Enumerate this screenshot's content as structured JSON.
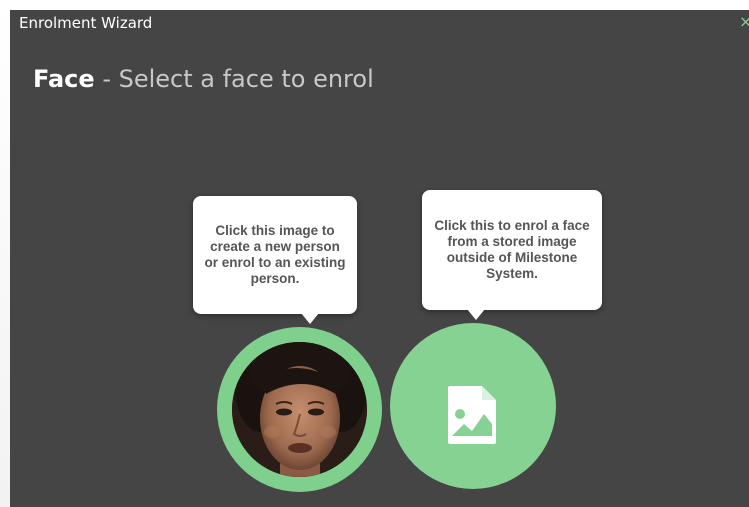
{
  "window": {
    "title": "Enrolment Wizard",
    "close_glyph": "×"
  },
  "heading": {
    "strong": "Face",
    "rest": " - Select a face to enrol"
  },
  "options": {
    "capture": {
      "tooltip": "Click this image to create a new person or enrol to an existing person.",
      "icon": "face-photo"
    },
    "upload": {
      "tooltip": "Click this to enrol a face from a stored image outside of Milestone System.",
      "icon": "image-file-icon"
    }
  },
  "colors": {
    "background": "#454545",
    "accent_green": "#7fd08d",
    "bubble": "#ffffff",
    "bubble_text": "#555555"
  }
}
